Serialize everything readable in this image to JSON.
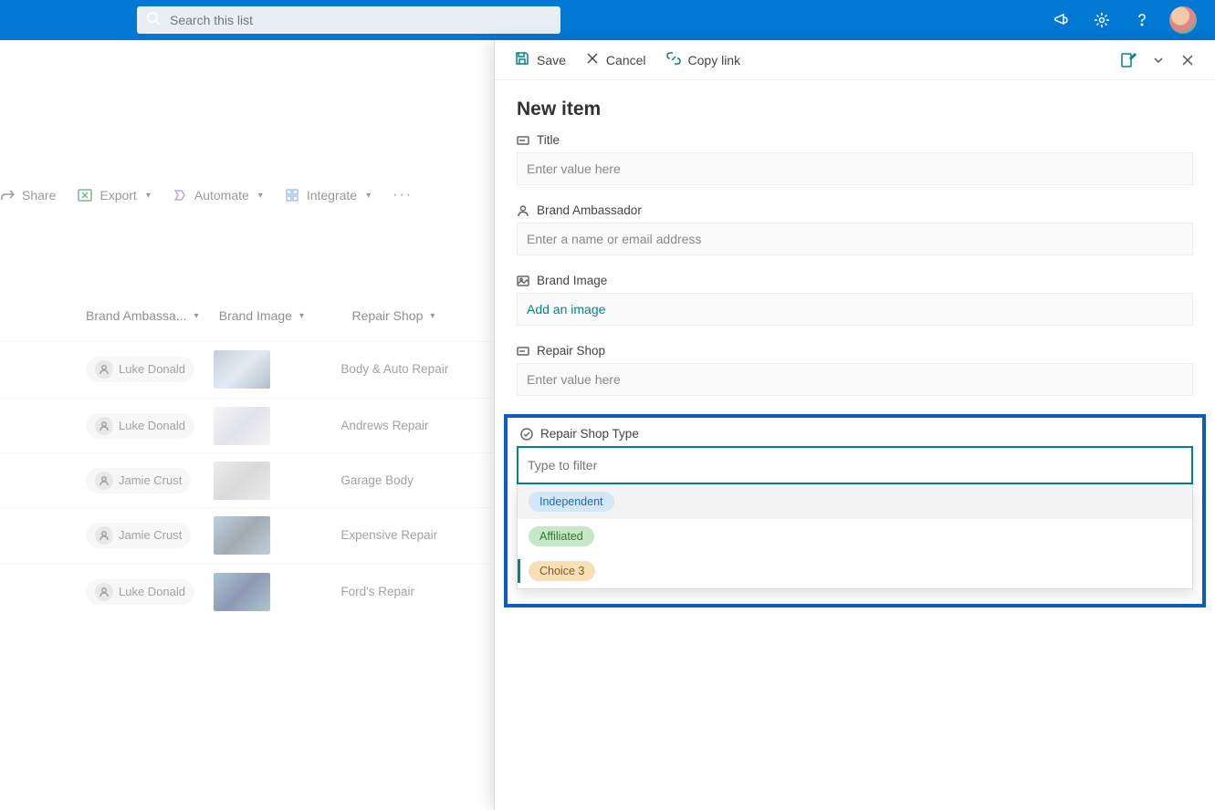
{
  "topbar": {
    "search_placeholder": "Search this list"
  },
  "commandbar": {
    "share": "Share",
    "export": "Export",
    "automate": "Automate",
    "integrate": "Integrate"
  },
  "columns": {
    "brand_ambassador": "Brand Ambassa...",
    "brand_image": "Brand Image",
    "repair_shop": "Repair Shop"
  },
  "rows": [
    {
      "ambassador": "Luke Donald",
      "repair_shop": "Body & Auto Repair"
    },
    {
      "ambassador": "Luke Donald",
      "repair_shop": "Andrews Repair"
    },
    {
      "ambassador": "Jamie Crust",
      "repair_shop": "Garage Body"
    },
    {
      "ambassador": "Jamie Crust",
      "repair_shop": "Expensive Repair"
    },
    {
      "ambassador": "Luke Donald",
      "repair_shop": "Ford's Repair"
    }
  ],
  "panel": {
    "toolbar": {
      "save": "Save",
      "cancel": "Cancel",
      "copy_link": "Copy link"
    },
    "title": "New item",
    "fields": {
      "title": {
        "label": "Title",
        "placeholder": "Enter value here"
      },
      "brand_ambassador": {
        "label": "Brand Ambassador",
        "placeholder": "Enter a name or email address"
      },
      "brand_image": {
        "label": "Brand Image",
        "action": "Add an image"
      },
      "repair_shop": {
        "label": "Repair Shop",
        "placeholder": "Enter value here"
      },
      "repair_shop_type": {
        "label": "Repair Shop Type",
        "filter_placeholder": "Type to filter",
        "options": [
          "Independent",
          "Affiliated",
          "Choice 3"
        ]
      }
    }
  }
}
